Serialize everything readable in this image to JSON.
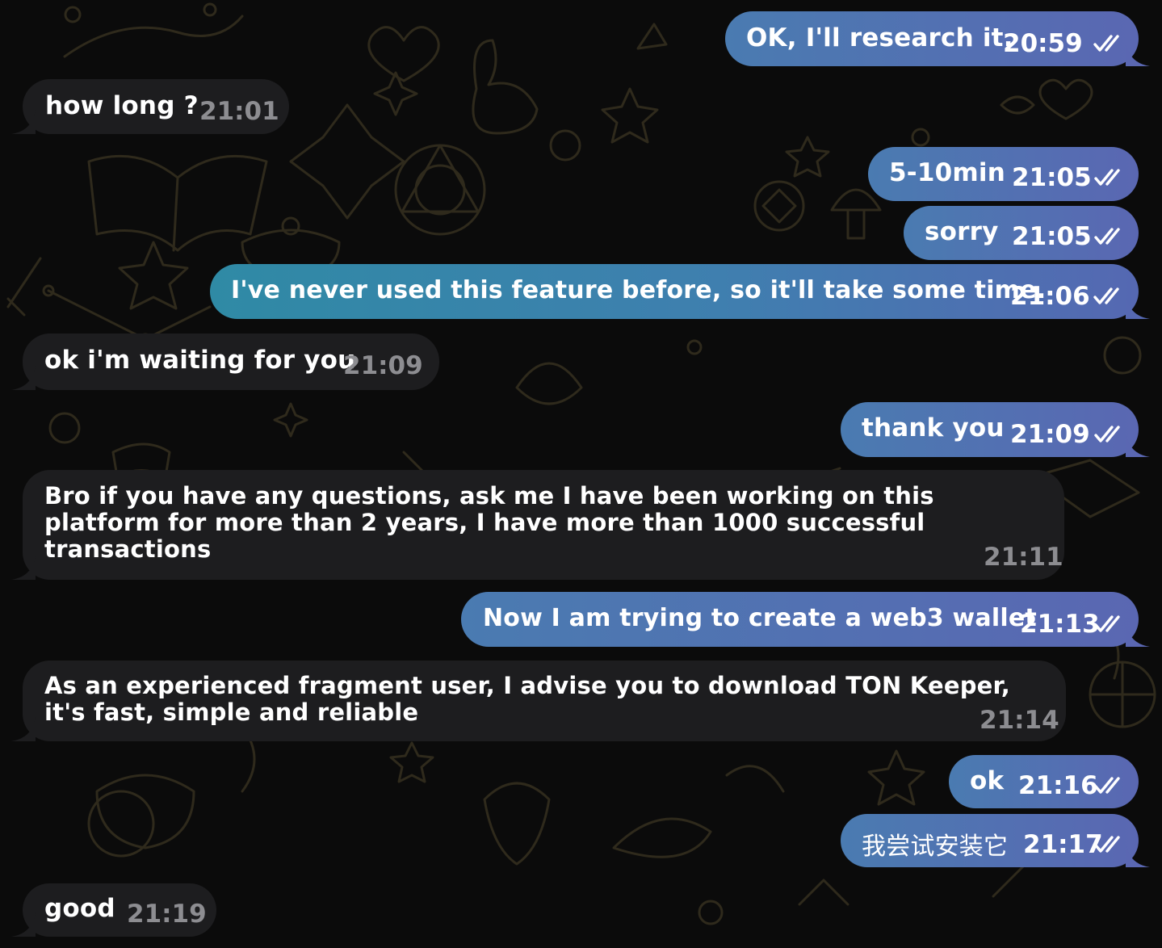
{
  "colors": {
    "outgoing_bubble": "#5a67b2",
    "outgoing_bubble_alt": "#2f8aa5",
    "incoming_bubble": "#1d1d1f",
    "background": "#0b0b0b",
    "incoming_time": "#8d8d91"
  },
  "icons": {
    "read_receipt": "double-check-icon"
  },
  "messages": [
    {
      "direction": "outgoing",
      "text": "OK, I'll research it.",
      "time": "20:59",
      "status": "read"
    },
    {
      "direction": "incoming",
      "text": "how long ?",
      "time": "21:01"
    },
    {
      "direction": "outgoing",
      "text": "5-10min",
      "time": "21:05",
      "status": "read"
    },
    {
      "direction": "outgoing",
      "text": "sorry",
      "time": "21:05",
      "status": "read"
    },
    {
      "direction": "outgoing",
      "text": "I've never used this feature before, so it'll take some time.",
      "time": "21:06",
      "status": "read"
    },
    {
      "direction": "incoming",
      "text": "ok i'm waiting for you",
      "time": "21:09"
    },
    {
      "direction": "outgoing",
      "text": "thank you",
      "time": "21:09",
      "status": "read"
    },
    {
      "direction": "incoming",
      "text": "Bro if you have any questions, ask me I have been working on this platform for more than 2 years, I have more than 1000 successful transactions",
      "time": "21:11"
    },
    {
      "direction": "outgoing",
      "text": "Now I am trying to create a web3 wallet",
      "time": "21:13",
      "status": "read"
    },
    {
      "direction": "incoming",
      "text": "As an experienced fragment user, I advise you to download TON Keeper, it's fast, simple and reliable",
      "time": "21:14"
    },
    {
      "direction": "outgoing",
      "text": "ok",
      "time": "21:16",
      "status": "read"
    },
    {
      "direction": "outgoing",
      "text": "我尝试安装它",
      "time": "21:17",
      "status": "read"
    },
    {
      "direction": "incoming",
      "text": "good",
      "time": "21:19"
    }
  ]
}
